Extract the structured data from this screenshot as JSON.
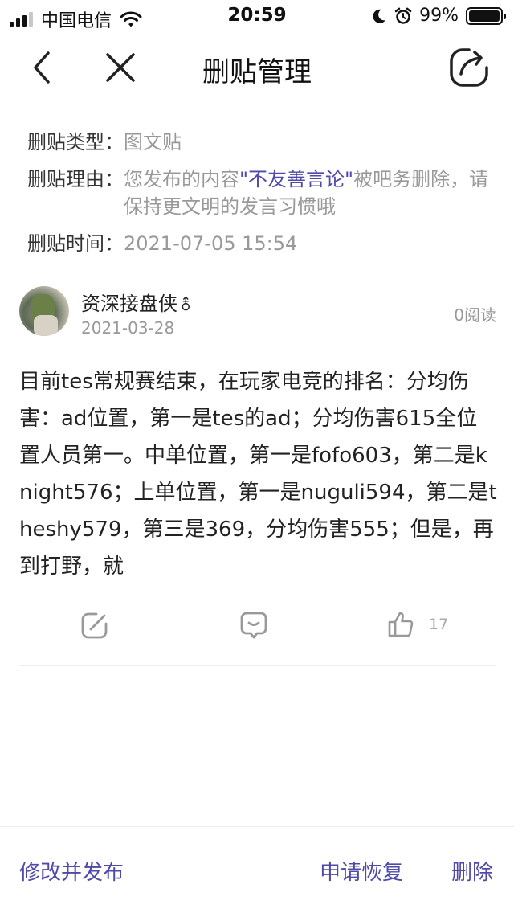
{
  "status_bar": {
    "carrier": "中国电信",
    "time": "20:59",
    "battery_percent": "99%",
    "battery_level": 0.99,
    "icons": [
      "signal-icon",
      "wifi-icon",
      "moon-icon",
      "alarm-icon",
      "battery-icon"
    ]
  },
  "nav": {
    "title": "删贴管理",
    "icons": [
      "back-arrow-icon",
      "close-icon",
      "share-icon"
    ]
  },
  "info": {
    "type_label": "删贴类型",
    "type_value": "图文贴",
    "reason_label": "删贴理由",
    "reason_prefix": "您发布的内容",
    "reason_highlight": "\"不友善言论\"",
    "reason_suffix": "被吧务删除，请保持更文明的发言习惯哦",
    "time_label": "删贴时间",
    "time_value": "2021-07-05 15:54",
    "colon": "："
  },
  "post": {
    "username": "资深接盘侠",
    "gender_symbol": "⚨",
    "date": "2021-03-28",
    "reads": "0阅读",
    "content": "目前tes常规赛结束，在玩家电竞的排名：分均伤害：ad位置，第一是tes的ad；分均伤害615全位置人员第一。中单位置，第一是fofo603，第二是knight576；上单位置，第一是nuguli594，第二是theshy579，第三是369，分均伤害555；但是，再到打野，就",
    "like_count": "17"
  },
  "bottom_bar": {
    "edit_publish": "修改并发布",
    "restore": "申请恢复",
    "delete": "删除"
  },
  "colors": {
    "accent": "#4f49a8",
    "muted": "#999999",
    "text": "#222222"
  }
}
